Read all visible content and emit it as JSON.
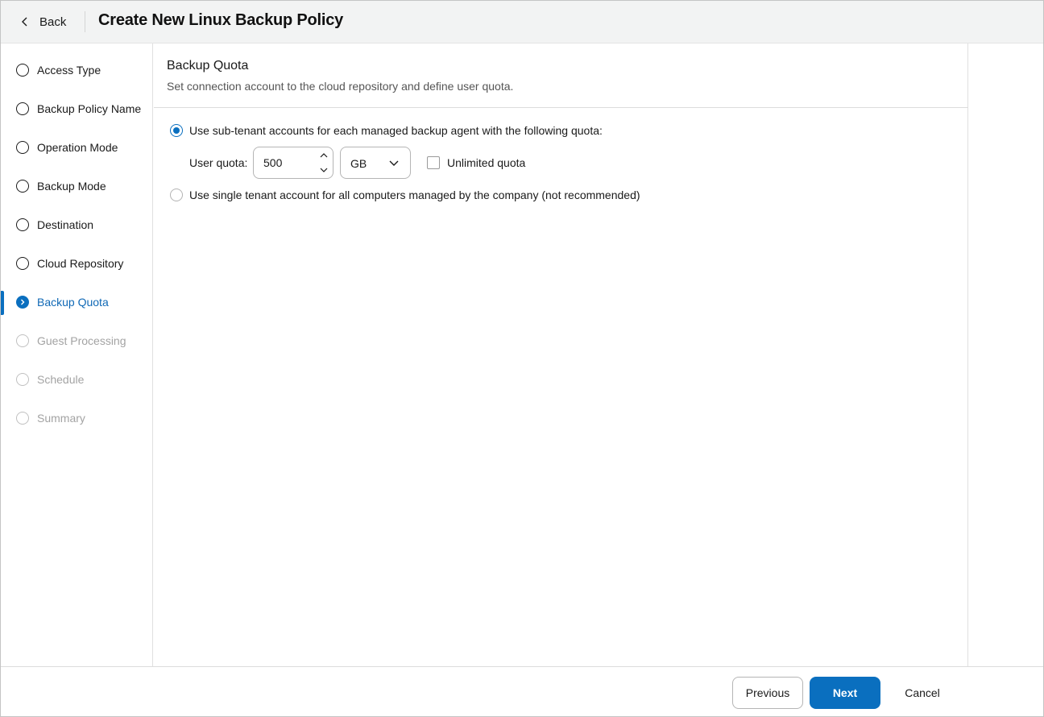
{
  "header": {
    "back_label": "Back",
    "title": "Create New Linux Backup Policy"
  },
  "steps": [
    {
      "label": "Access Type",
      "state": "done"
    },
    {
      "label": "Backup Policy Name",
      "state": "done"
    },
    {
      "label": "Operation Mode",
      "state": "done"
    },
    {
      "label": "Backup Mode",
      "state": "done"
    },
    {
      "label": "Destination",
      "state": "done"
    },
    {
      "label": "Cloud Repository",
      "state": "done"
    },
    {
      "label": "Backup Quota",
      "state": "active"
    },
    {
      "label": "Guest Processing",
      "state": "disabled"
    },
    {
      "label": "Schedule",
      "state": "disabled"
    },
    {
      "label": "Summary",
      "state": "disabled"
    }
  ],
  "section": {
    "title": "Backup Quota",
    "subtitle": "Set connection account to the cloud repository and define user quota."
  },
  "options": {
    "sub_tenant": {
      "label": "Use sub-tenant accounts for each managed backup agent with the following quota:",
      "selected": true
    },
    "single_tenant": {
      "label": "Use single tenant account for all computers managed by the company (not recommended)",
      "selected": false
    }
  },
  "quota": {
    "label": "User quota:",
    "value": "500",
    "unit": "GB",
    "unlimited_label": "Unlimited quota",
    "unlimited_checked": false
  },
  "footer": {
    "previous_label": "Previous",
    "next_label": "Next",
    "cancel_label": "Cancel"
  },
  "colors": {
    "accent": "#0a6fbf",
    "active_text": "#1069b6",
    "disabled_text": "#a3a3a3",
    "header_bg": "#f2f3f3"
  },
  "icons": {
    "back": "chevron-left-icon",
    "active_step": "chevron-right-icon",
    "stepper_up": "chevron-up-icon",
    "stepper_down": "chevron-down-icon",
    "select": "chevron-down-icon"
  }
}
